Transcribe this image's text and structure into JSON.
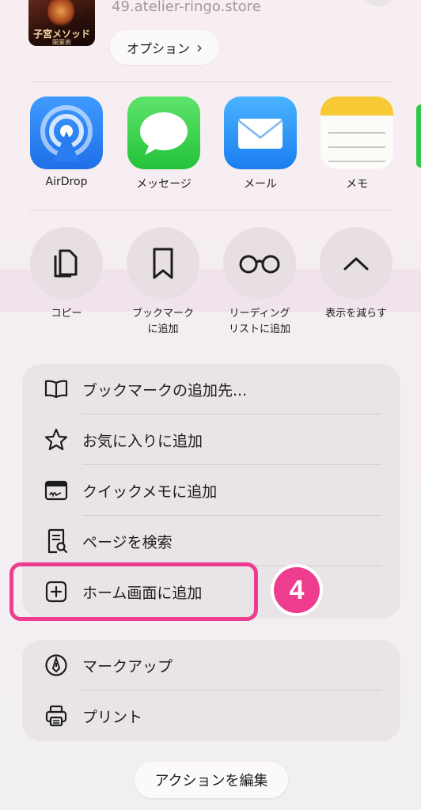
{
  "preview": {
    "thumb_title": "子宮メソッド",
    "thumb_sub": "開業術",
    "domain": "49.atelier-ringo.store",
    "options_label": "オプション",
    "options_chevron": "›"
  },
  "apps": [
    {
      "label": "AirDrop",
      "icon": "airdrop-icon"
    },
    {
      "label": "メッセージ",
      "icon": "messages-icon"
    },
    {
      "label": "メール",
      "icon": "mail-icon"
    },
    {
      "label": "メモ",
      "icon": "notes-icon"
    }
  ],
  "actions": [
    {
      "line1": "コピー",
      "line2": "",
      "icon": "copy-icon"
    },
    {
      "line1": "ブックマーク",
      "line2": "に追加",
      "icon": "bookmark-icon"
    },
    {
      "line1": "リーディング",
      "line2": "リストに追加",
      "icon": "glasses-icon"
    },
    {
      "line1": "表示を減らす",
      "line2": "",
      "icon": "chevron-up-icon"
    }
  ],
  "menu": [
    {
      "label": "ブックマークの追加先...",
      "icon": "book-icon"
    },
    {
      "label": "お気に入りに追加",
      "icon": "star-icon"
    },
    {
      "label": "クイックメモに追加",
      "icon": "quick-note-icon"
    },
    {
      "label": "ページを検索",
      "icon": "find-in-page-icon"
    },
    {
      "label": "ホーム画面に追加",
      "icon": "plus-square-icon"
    }
  ],
  "menu2": [
    {
      "label": "マークアップ",
      "icon": "markup-icon"
    },
    {
      "label": "プリント",
      "icon": "printer-icon"
    }
  ],
  "step_badge": "4",
  "edit_actions_label": "アクションを編集",
  "colors": {
    "highlight": "#ee3d8f",
    "badge_text": "#ffffff"
  }
}
